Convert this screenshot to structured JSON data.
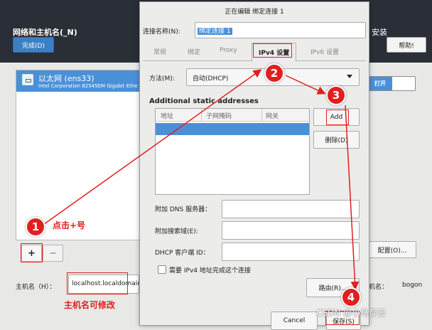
{
  "background_window": {
    "title": "网络和主机名(_N)",
    "done_button": "完成(D)",
    "install_label": "安装",
    "help_button": "帮助!",
    "interface": {
      "name": "以太网 (ens33)",
      "description": "Intel Corporation 82545EM Gigabit Ethe"
    },
    "toggle_label": "打开",
    "add_button": "+",
    "remove_button": "−",
    "configure_button": "配置(O)...",
    "hostname_label": "主机名（H）：",
    "hostname_value": "localhost.localdomain",
    "current_hostname_label": "主机名：",
    "current_hostname_value": "bogon"
  },
  "dialog": {
    "title": "正在编辑 绑定连接 1",
    "connection_name_label": "连接名称(N):",
    "connection_name_value": "绑定连接 1",
    "tabs": [
      {
        "label": "常规",
        "active": false
      },
      {
        "label": "绑定",
        "active": false
      },
      {
        "label": "Proxy",
        "active": false
      },
      {
        "label": "IPv4 设置",
        "active": true
      },
      {
        "label": "IPv6 设置",
        "active": false
      }
    ],
    "method_label": "方法(M):",
    "method_value": "自动(DHCP)",
    "static_addresses_title": "Additional static addresses",
    "address_columns": [
      "地址",
      "子网掩码",
      "网关"
    ],
    "add_button": "Add",
    "delete_button": "删除(D)",
    "dns_label": "附加 DNS 服务器：",
    "search_domains_label": "附加搜索域(E):",
    "dhcp_client_id_label": "DHCP 客户端 ID：",
    "require_ipv4_label": "需要 IPv4 地址完成这个连接",
    "routes_button": "路由(R)...",
    "cancel_button": "Cancel",
    "save_button": "保存(S)"
  },
  "annotations": {
    "step1": "1",
    "step2": "2",
    "step3": "3",
    "step4": "4",
    "step1_text": "点击+号",
    "hostname_note": "主机名可修改",
    "watermark": "CSDN @小马穿云"
  },
  "colors": {
    "header_bg": "#2a2e36",
    "accent_blue": "#4a90d9",
    "annotation_red": "#e02020"
  }
}
